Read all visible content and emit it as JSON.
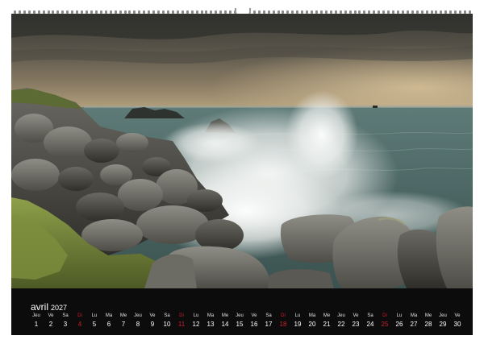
{
  "calendar": {
    "month": "avril",
    "year": "2027",
    "sunday_color": "#c8202d",
    "days": [
      {
        "wd": "Jeu",
        "d": "1"
      },
      {
        "wd": "Ve",
        "d": "2"
      },
      {
        "wd": "Sa",
        "d": "3"
      },
      {
        "wd": "Di",
        "d": "4",
        "sun": true
      },
      {
        "wd": "Lu",
        "d": "5"
      },
      {
        "wd": "Ma",
        "d": "6"
      },
      {
        "wd": "Me",
        "d": "7"
      },
      {
        "wd": "Jeu",
        "d": "8"
      },
      {
        "wd": "Ve",
        "d": "9"
      },
      {
        "wd": "Sa",
        "d": "10"
      },
      {
        "wd": "Di",
        "d": "11",
        "sun": true
      },
      {
        "wd": "Lu",
        "d": "12"
      },
      {
        "wd": "Ma",
        "d": "13"
      },
      {
        "wd": "Me",
        "d": "14"
      },
      {
        "wd": "Jeu",
        "d": "15"
      },
      {
        "wd": "Ve",
        "d": "16"
      },
      {
        "wd": "Sa",
        "d": "17"
      },
      {
        "wd": "Di",
        "d": "18",
        "sun": true
      },
      {
        "wd": "Lu",
        "d": "19"
      },
      {
        "wd": "Ma",
        "d": "20"
      },
      {
        "wd": "Me",
        "d": "21"
      },
      {
        "wd": "Jeu",
        "d": "22"
      },
      {
        "wd": "Ve",
        "d": "23"
      },
      {
        "wd": "Sa",
        "d": "24"
      },
      {
        "wd": "Di",
        "d": "25",
        "sun": true
      },
      {
        "wd": "Lu",
        "d": "26"
      },
      {
        "wd": "Ma",
        "d": "27"
      },
      {
        "wd": "Me",
        "d": "28"
      },
      {
        "wd": "Jeu",
        "d": "29"
      },
      {
        "wd": "Ve",
        "d": "30"
      }
    ]
  }
}
